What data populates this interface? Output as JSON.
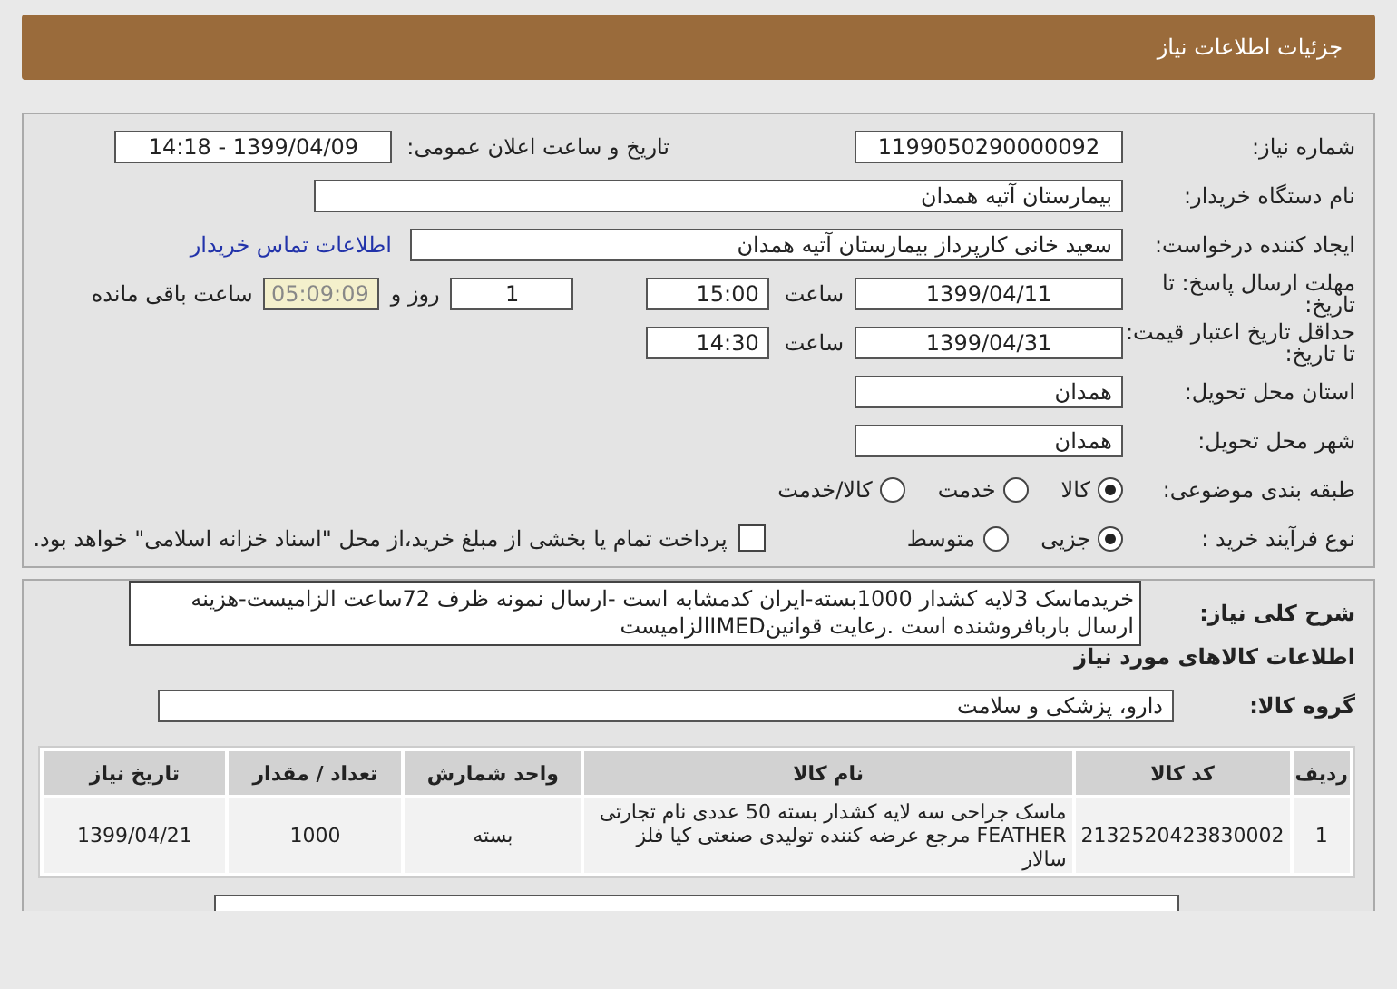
{
  "header": {
    "title": "جزئیات اطلاعات نیاز"
  },
  "need_number": {
    "label": "شماره نیاز:",
    "value": "1199050290000092"
  },
  "announce": {
    "label": "تاریخ و ساعت اعلان عمومی:",
    "value": "1399/04/09 - 14:18"
  },
  "buyer": {
    "label": "نام دستگاه خریدار:",
    "value": "بیمارستان آتیه همدان"
  },
  "creator": {
    "label": "ایجاد کننده درخواست:",
    "value": "سعید خانی کارپرداز بیمارستان آتیه همدان",
    "link": "اطلاعات تماس خریدار"
  },
  "deadline": {
    "label": "مهلت ارسال پاسخ: تا تاریخ:",
    "date": "1399/04/11",
    "time_label": "ساعت",
    "time": "15:00",
    "days": "1",
    "days_label": "روز و",
    "remaining": "05:09:09",
    "remaining_label": "ساعت باقی مانده"
  },
  "validity": {
    "label": "حداقل تاریخ اعتبار قیمت: تا تاریخ:",
    "date": "1399/04/31",
    "time_label": "ساعت",
    "time": "14:30"
  },
  "province": {
    "label": "استان محل تحویل:",
    "value": "همدان"
  },
  "city": {
    "label": "شهر محل تحویل:",
    "value": "همدان"
  },
  "category": {
    "label": "طبقه بندی موضوعی:",
    "options": [
      {
        "label": "کالا",
        "selected": true
      },
      {
        "label": "خدمت",
        "selected": false
      },
      {
        "label": "کالا/خدمت",
        "selected": false
      }
    ]
  },
  "process": {
    "label": "نوع فرآیند خرید :",
    "options": [
      {
        "label": "جزیی",
        "selected": true
      },
      {
        "label": "متوسط",
        "selected": false
      }
    ],
    "payment": {
      "label": "پرداخت تمام یا بخشی از مبلغ خرید،از محل \"اسناد خزانه اسلامی\" خواهد بود.",
      "checked": false
    }
  },
  "description": {
    "label": "شرح کلی نیاز:",
    "value": "خریدماسک 3لایه کشدار 1000بسته-ایران کدمشابه است -ارسال نمونه ظرف 72ساعت الزامیست-هزینه ارسال باربافروشنده است .رعایت قوانینIMEDالزامیست"
  },
  "goods": {
    "title": "اطلاعات کالاهای مورد نیاز",
    "group_label": "گروه کالا:",
    "group_value": "دارو، پزشکی و سلامت"
  },
  "table": {
    "columns": [
      "ردیف",
      "کد کالا",
      "نام کالا",
      "واحد شمارش",
      "تعداد / مقدار",
      "تاریخ نیاز"
    ],
    "rows": [
      [
        "1",
        "2132520423830002",
        "ماسک جراحی سه لایه کشدار بسته 50 عددی نام تجارتی FEATHER مرجع عرضه کننده تولیدی صنعتی کیا فلز سالار",
        "بسته",
        "1000",
        "1399/04/21"
      ]
    ]
  }
}
